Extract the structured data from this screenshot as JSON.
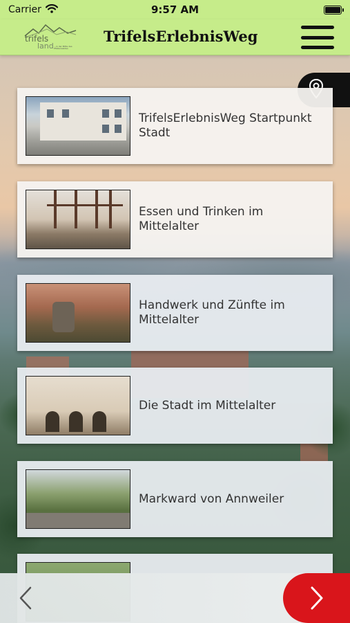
{
  "status_bar": {
    "carrier": "Carrier",
    "time": "9:57 AM"
  },
  "header": {
    "title": "TrifelsErlebnisWeg",
    "logo_text": "trifels land",
    "logo_tagline": "…in der Mitte des Pfälzerwaldes"
  },
  "colors": {
    "header_bg": "#c6ec8a",
    "next_button": "#d9151b",
    "map_pill": "#111111"
  },
  "icons": {
    "menu": "hamburger-menu-icon",
    "map": "map-pin-icon",
    "prev": "chevron-left-icon",
    "next": "chevron-right-icon",
    "wifi": "wifi-icon",
    "battery": "battery-icon"
  },
  "stations": [
    {
      "label": "TrifelsErlebnisWeg Startpunkt Stadt",
      "image": "town-square-photo"
    },
    {
      "label": "Essen und Trinken im Mittelalter",
      "image": "half-timbered-courtyard-photo"
    },
    {
      "label": "Handwerk und Zünfte im Mittelalter",
      "image": "wine-press-garden-photo"
    },
    {
      "label": "Die Stadt im Mittelalter",
      "image": "arcade-building-photo"
    },
    {
      "label": "Markward von Annweiler",
      "image": "park-stairs-photo"
    },
    {
      "label": "",
      "image": "forest-photo"
    }
  ]
}
